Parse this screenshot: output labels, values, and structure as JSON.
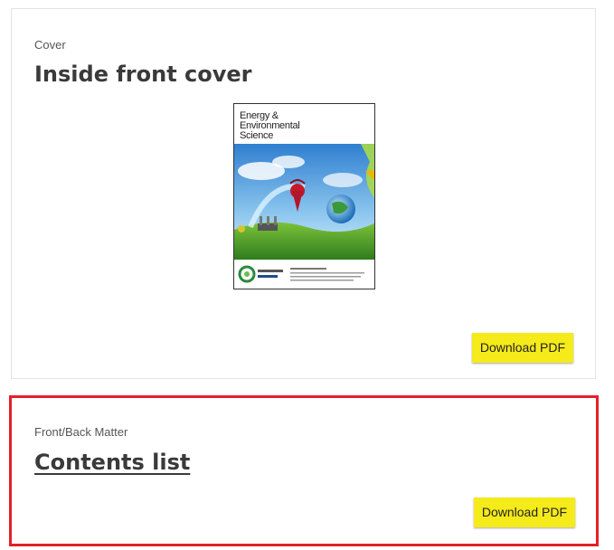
{
  "cards": [
    {
      "category": "Cover",
      "title": "Inside front cover",
      "download_label": "Download PDF",
      "cover": {
        "journal_title_line1": "Energy &",
        "journal_title_line2": "Environmental",
        "journal_title_line3": "Science"
      }
    },
    {
      "category": "Front/Back Matter",
      "title": "Contents list",
      "download_label": "Download PDF"
    }
  ],
  "colors": {
    "download_button": "#f5ea1a",
    "highlight_border": "#e3202a",
    "card_border": "#e3e3e3"
  }
}
